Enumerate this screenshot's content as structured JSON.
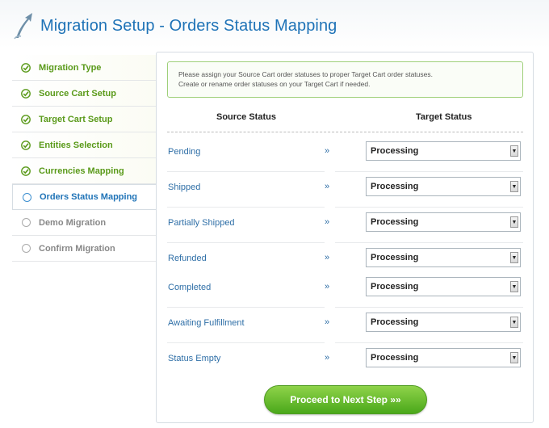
{
  "header": {
    "title": "Migration Setup - Orders Status Mapping"
  },
  "sidebar": {
    "steps": [
      {
        "label": "Migration Type",
        "state": "done"
      },
      {
        "label": "Source Cart Setup",
        "state": "done"
      },
      {
        "label": "Target Cart Setup",
        "state": "done"
      },
      {
        "label": "Entities Selection",
        "state": "done"
      },
      {
        "label": "Currencies Mapping",
        "state": "done"
      },
      {
        "label": "Orders Status Mapping",
        "state": "current"
      },
      {
        "label": "Demo Migration",
        "state": "pending"
      },
      {
        "label": "Confirm Migration",
        "state": "pending"
      }
    ]
  },
  "notice": {
    "line1": "Please assign your Source Cart order statuses to proper Target Cart order statuses.",
    "line2": "Create or rename order statuses on your Target Cart if needed."
  },
  "table": {
    "source_header": "Source Status",
    "target_header": "Target Status",
    "arrow": "»",
    "rows": [
      {
        "source": "Pending",
        "target": "Processing"
      },
      {
        "source": "Shipped",
        "target": "Processing"
      },
      {
        "source": "Partially Shipped",
        "target": "Processing"
      },
      {
        "source": "Refunded",
        "target": "Processing"
      },
      {
        "source": "Completed",
        "target": "Processing"
      },
      {
        "source": "Awaiting Fulfillment",
        "target": "Processing"
      },
      {
        "source": "Status Empty",
        "target": "Processing"
      }
    ]
  },
  "actions": {
    "proceed_label": "Proceed to Next Step »»"
  },
  "colors": {
    "accent": "#1f73b7",
    "done": "#5a9a1a",
    "button": "#5cb82a"
  }
}
